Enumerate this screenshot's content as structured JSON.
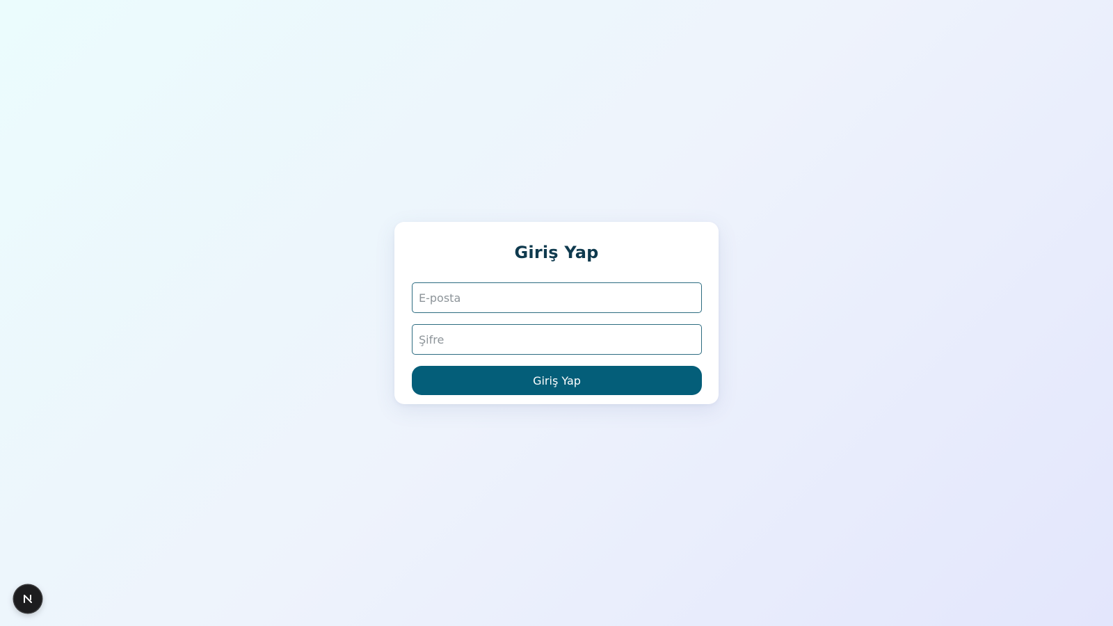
{
  "login": {
    "title": "Giriş Yap",
    "email_placeholder": "E-posta",
    "password_placeholder": "Şifre",
    "submit_label": "Giriş Yap"
  },
  "dev_indicator": {
    "icon": "nextjs-logo-icon",
    "letter": "N"
  },
  "colors": {
    "primary": "#045e79",
    "title": "#0f3a4e",
    "input_border": "#2c6b80",
    "background_start": "#ebfcfd",
    "background_end": "#e3e6fc"
  }
}
